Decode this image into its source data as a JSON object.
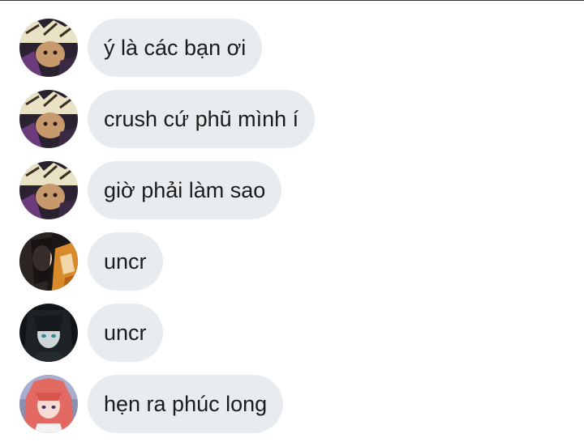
{
  "messages": [
    {
      "text": "ý là các bạn ơi",
      "avatar": "avatar-yellow-hair-character"
    },
    {
      "text": "crush cứ phũ mình í",
      "avatar": "avatar-yellow-hair-character"
    },
    {
      "text": "giờ phải làm sao",
      "avatar": "avatar-yellow-hair-character"
    },
    {
      "text": "uncr",
      "avatar": "avatar-dark-hair-orange-character"
    },
    {
      "text": "uncr",
      "avatar": "avatar-dark-hair-teal-eyes-character"
    },
    {
      "text": "hẹn ra phúc long",
      "avatar": "avatar-pink-hair-character"
    }
  ],
  "colors": {
    "bubble": "#e9ecef",
    "text": "#1c1c1c",
    "background": "#ffffff"
  }
}
